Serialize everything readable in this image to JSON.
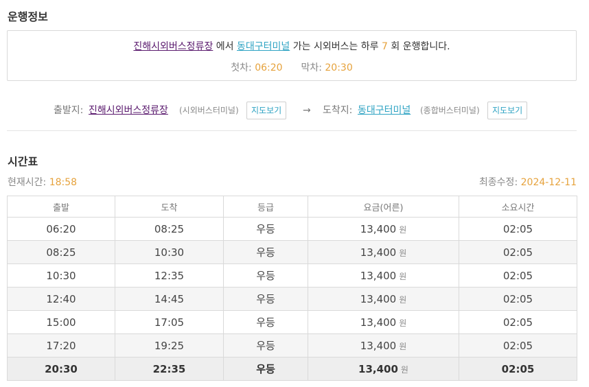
{
  "sections": {
    "operation_title": "운행정보",
    "timetable_title": "시간표"
  },
  "summary": {
    "origin": "진해시외버스정류장",
    "from_word": "에서",
    "destination": "동대구터미널",
    "mid_text": "가는 시외버스는 하루",
    "count": "7",
    "end_text": "회 운행합니다.",
    "first_label": "첫차:",
    "first_time": "06:20",
    "last_label": "막차:",
    "last_time": "20:30"
  },
  "route": {
    "dep_label": "출발지:",
    "dep_name": "진해시외버스정류장",
    "dep_type": "(시외버스터미널)",
    "map_button": "지도보기",
    "arrow": "→",
    "arr_label": "도착지:",
    "arr_name": "동대구터미널",
    "arr_type": "(종합버스터미널)"
  },
  "status": {
    "now_label": "현재시간:",
    "now_value": "18:58",
    "updated_label": "최종수정:",
    "updated_value": "2024-12-11"
  },
  "colors": {
    "accent_orange": "#e6a23c",
    "link_purple": "#5a1a6e",
    "link_cyan": "#2ea3c3"
  },
  "table": {
    "headers": [
      "출발",
      "도착",
      "등급",
      "요금(어른)",
      "소요시간"
    ],
    "currency": "원",
    "rows": [
      {
        "dep": "06:20",
        "arr": "08:25",
        "grade": "우등",
        "fare": "13,400",
        "dur": "02:05"
      },
      {
        "dep": "08:25",
        "arr": "10:30",
        "grade": "우등",
        "fare": "13,400",
        "dur": "02:05"
      },
      {
        "dep": "10:30",
        "arr": "12:35",
        "grade": "우등",
        "fare": "13,400",
        "dur": "02:05"
      },
      {
        "dep": "12:40",
        "arr": "14:45",
        "grade": "우등",
        "fare": "13,400",
        "dur": "02:05"
      },
      {
        "dep": "15:00",
        "arr": "17:05",
        "grade": "우등",
        "fare": "13,400",
        "dur": "02:05"
      },
      {
        "dep": "17:20",
        "arr": "19:25",
        "grade": "우등",
        "fare": "13,400",
        "dur": "02:05"
      },
      {
        "dep": "20:30",
        "arr": "22:35",
        "grade": "우등",
        "fare": "13,400",
        "dur": "02:05"
      }
    ]
  }
}
